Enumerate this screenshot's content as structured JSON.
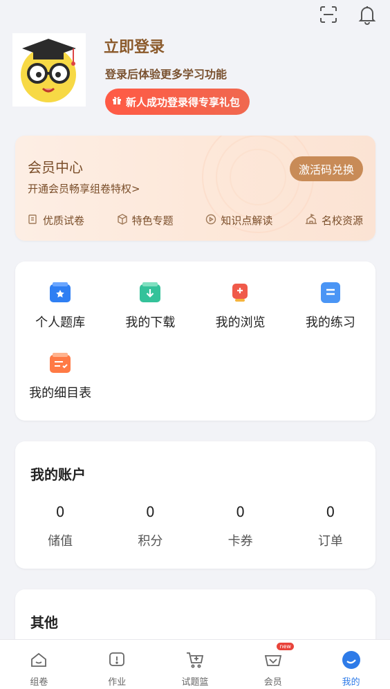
{
  "header": {
    "icons": [
      "scan-icon",
      "bell-icon"
    ]
  },
  "profile": {
    "title": "立即登录",
    "subtitle": "登录后体验更多学习功能",
    "gift_label": "新人成功登录得专享礼包"
  },
  "vip": {
    "title": "会员中心",
    "subtitle": "开通会员畅享组卷特权>",
    "activate_label": "激活码兑换",
    "features": [
      "优质试卷",
      "特色专题",
      "知识点解读",
      "名校资源"
    ]
  },
  "tools": {
    "items": [
      {
        "label": "个人题库",
        "color": "#2f7ff3"
      },
      {
        "label": "我的下载",
        "color": "#34c29a"
      },
      {
        "label": "我的浏览",
        "color": "#f05a4a"
      },
      {
        "label": "我的练习",
        "color": "#4a95f5"
      },
      {
        "label": "我的细目表",
        "color": "#ff7a45"
      }
    ]
  },
  "account": {
    "title": "我的账户",
    "items": [
      {
        "value": "0",
        "label": "储值"
      },
      {
        "value": "0",
        "label": "积分"
      },
      {
        "value": "0",
        "label": "卡券"
      },
      {
        "value": "0",
        "label": "订单"
      }
    ]
  },
  "other": {
    "title": "其他"
  },
  "tabbar": {
    "items": [
      {
        "label": "组卷"
      },
      {
        "label": "作业"
      },
      {
        "label": "试题篮"
      },
      {
        "label": "会员",
        "badge": "new"
      },
      {
        "label": "我的"
      }
    ],
    "active_color": "#2e7be8"
  }
}
